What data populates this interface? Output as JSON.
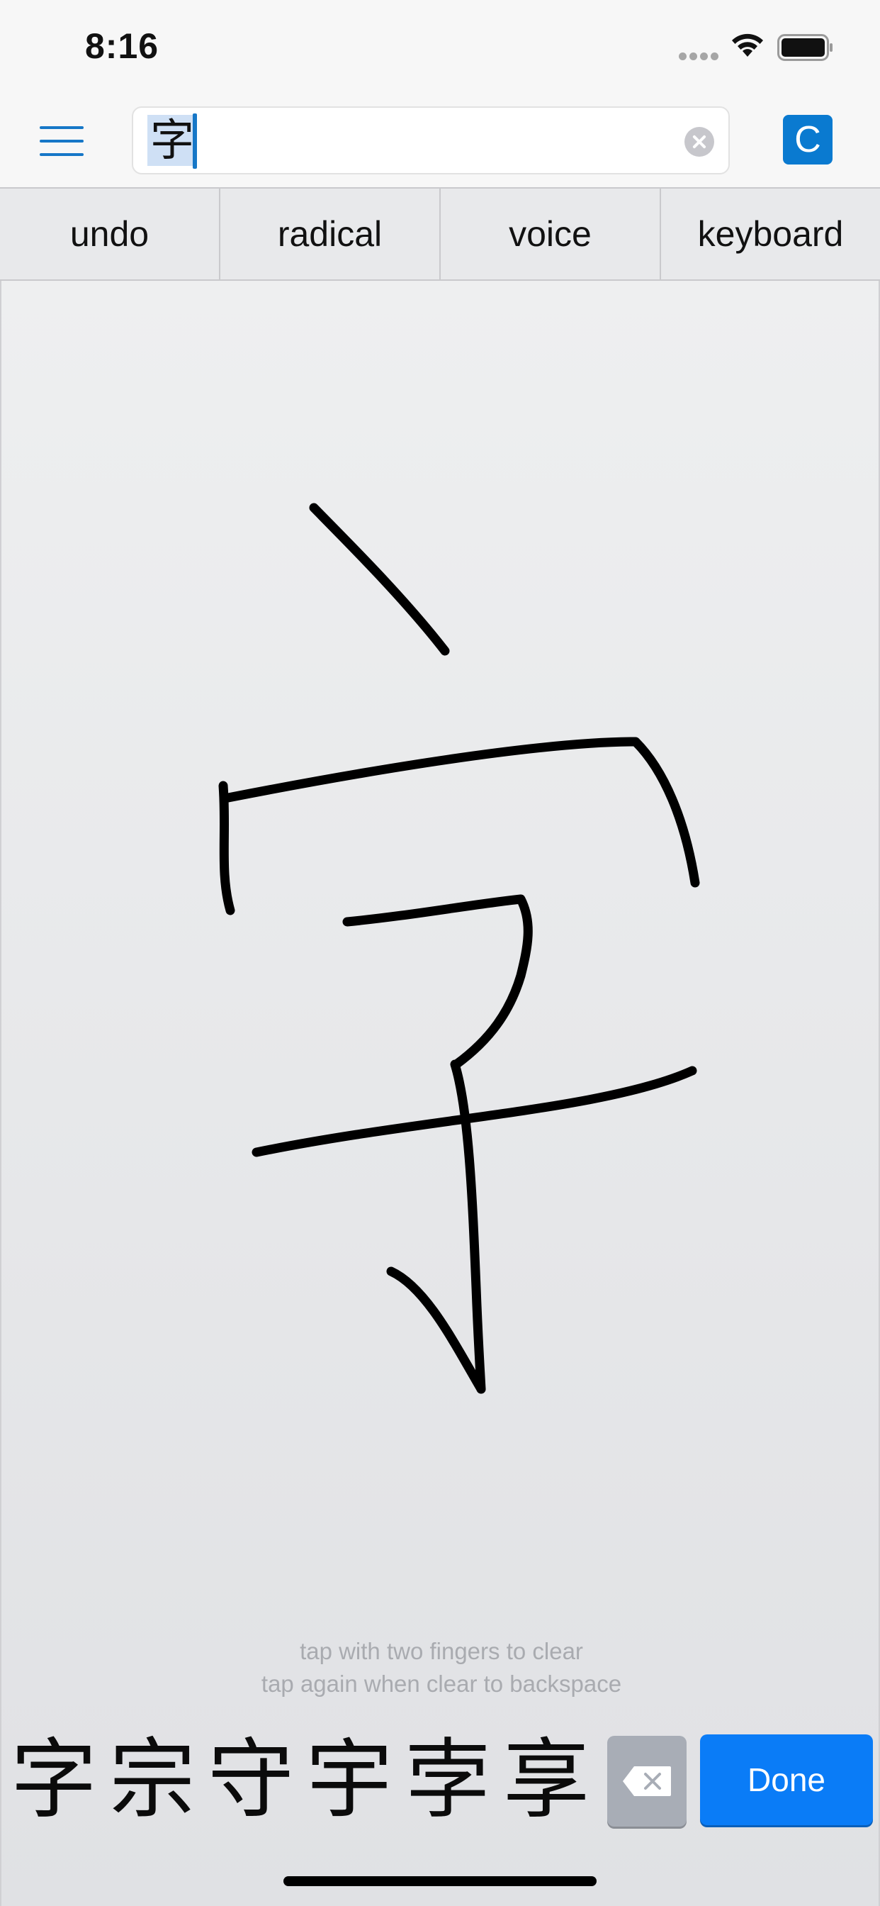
{
  "status_bar": {
    "time": "8:16",
    "icons": [
      "cellular-signal-icon",
      "wifi-icon",
      "battery-icon"
    ]
  },
  "nav": {
    "menu_icon": "hamburger-menu-icon",
    "search_value": "字",
    "clear_icon": "clear-circle-icon",
    "c_button_label": "C",
    "accent_color": "#1677c7"
  },
  "toolbar": {
    "buttons": [
      "undo",
      "radical",
      "voice",
      "keyboard"
    ]
  },
  "drawing": {
    "hint_line1": "tap with two fingers to clear",
    "hint_line2": "tap again when clear to backspace",
    "ink_color": "#000000"
  },
  "candidates": [
    "字",
    "宗",
    "守",
    "宇",
    "孛",
    "享"
  ],
  "actions": {
    "backspace_icon": "backspace-icon",
    "done_label": "Done",
    "done_color": "#0a7cf7"
  }
}
